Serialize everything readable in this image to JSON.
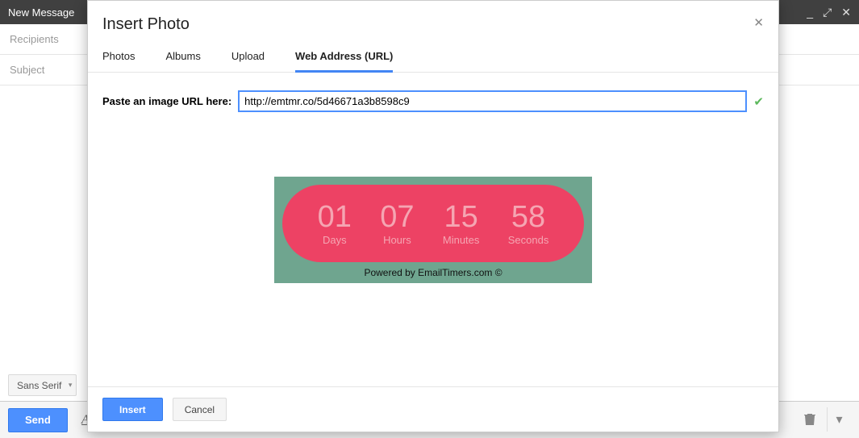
{
  "compose": {
    "title": "New Message",
    "recipients_placeholder": "Recipients",
    "subject_placeholder": "Subject",
    "send_label": "Send",
    "font_label": "Sans Serif"
  },
  "modal": {
    "title": "Insert Photo",
    "tabs": {
      "photos": "Photos",
      "albums": "Albums",
      "upload": "Upload",
      "web": "Web Address (URL)"
    },
    "url_label": "Paste an image URL here:",
    "url_value": "http://emtmr.co/5d46671a3b8598c9",
    "insert_label": "Insert",
    "cancel_label": "Cancel"
  },
  "countdown": {
    "bg_color": "#6fa58f",
    "pill_color": "#ed4264",
    "segments": [
      {
        "value": "01",
        "label": "Days"
      },
      {
        "value": "07",
        "label": "Hours"
      },
      {
        "value": "15",
        "label": "Minutes"
      },
      {
        "value": "58",
        "label": "Seconds"
      }
    ],
    "powered": "Powered by EmailTimers.com ©"
  }
}
